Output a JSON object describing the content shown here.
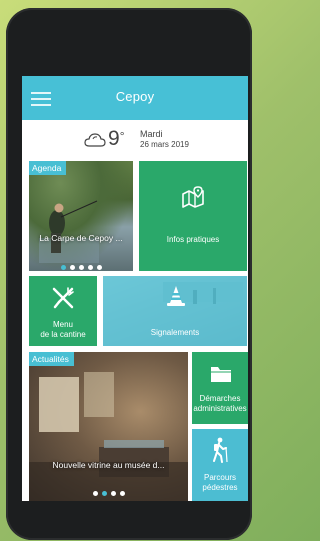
{
  "app": {
    "title": "Cepoy"
  },
  "weather": {
    "temperature": "9",
    "unit": "°",
    "day": "Mardi",
    "date": "26 mars 2019",
    "icon": "cloud-sun-icon"
  },
  "tiles": {
    "agenda": {
      "tag": "Agenda",
      "caption": "La Carpe de Cepoy ...",
      "dots": 5,
      "active_dot": 0
    },
    "infos": {
      "label": "Infos pratiques",
      "icon": "map-pin-icon"
    },
    "cantine": {
      "label_line1": "Menu",
      "label_line2": "de la cantine",
      "icon": "fork-knife-icon"
    },
    "signalements": {
      "label": "Signalements",
      "icon": "traffic-cone-icon"
    },
    "actualites": {
      "tag": "Actualités",
      "caption": "Nouvelle vitrine au musée d...",
      "dots": 4,
      "active_dot": 1
    },
    "demarches": {
      "label_line1": "Démarches",
      "label_line2": "administratives",
      "icon": "folder-icon"
    },
    "parcours": {
      "label_line1": "Parcours",
      "label_line2": "pédestres",
      "icon": "hiker-icon"
    }
  },
  "colors": {
    "accent": "#47c0d6",
    "green": "#2aa86a",
    "frame": "#1c1e1f"
  }
}
